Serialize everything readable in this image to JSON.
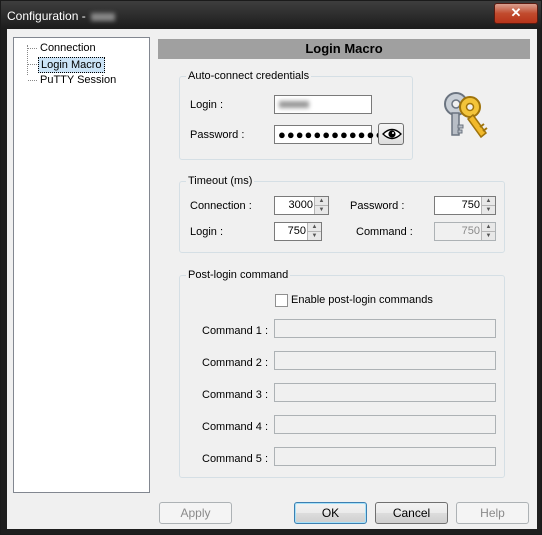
{
  "window": {
    "title": "Configuration - ",
    "close_label": "✕"
  },
  "tree": {
    "items": [
      {
        "label": "Connection"
      },
      {
        "label": "Login Macro"
      },
      {
        "label": "PuTTY Session"
      }
    ],
    "selected": "Login Macro"
  },
  "panel": {
    "header": "Login Macro",
    "auto_connect": {
      "legend": "Auto-connect credentials",
      "login_label": "Login :",
      "password_label": "Password :",
      "password_value": "●●●●●●●●●●●●●●"
    },
    "timeout": {
      "legend": "Timeout (ms)",
      "connection_label": "Connection :",
      "connection_value": "3000",
      "password_label": "Password :",
      "password_value": "750",
      "login_label": "Login :",
      "login_value": "750",
      "command_label": "Command :",
      "command_value": "750"
    },
    "post_login": {
      "legend": "Post-login command",
      "enable_label": "Enable post-login commands",
      "enabled": false,
      "commands": [
        {
          "label": "Command 1 :",
          "value": ""
        },
        {
          "label": "Command 2 :",
          "value": ""
        },
        {
          "label": "Command 3 :",
          "value": ""
        },
        {
          "label": "Command 4 :",
          "value": ""
        },
        {
          "label": "Command 5 :",
          "value": ""
        }
      ]
    }
  },
  "buttons": {
    "apply": "Apply",
    "ok": "OK",
    "cancel": "Cancel",
    "help": "Help"
  },
  "icons": {
    "keys": "keys-icon",
    "eye": "eye-icon"
  }
}
